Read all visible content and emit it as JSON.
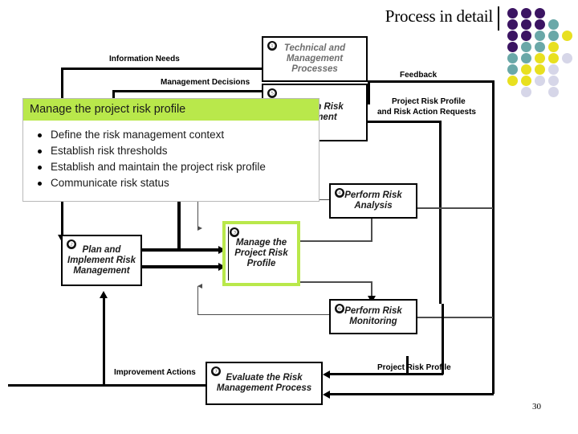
{
  "slide": {
    "title": "Process in detail",
    "page_number": "30"
  },
  "theme": {
    "accent_green": "#b9e84b",
    "dot_purple": "#3b1462",
    "dot_teal": "#6aa8a8",
    "dot_yellow": "#e8e020",
    "dot_lavender": "#d6d6e8",
    "line_black": "#000000"
  },
  "dot_grid": {
    "rows": 8,
    "cols": 5,
    "dot_size": 13,
    "step_x": 17,
    "step_y": 14,
    "pattern": [
      [
        "purple",
        "purple",
        "purple",
        "none",
        "none"
      ],
      [
        "purple",
        "purple",
        "purple",
        "teal",
        "none"
      ],
      [
        "purple",
        "purple",
        "teal",
        "teal",
        "yellow"
      ],
      [
        "purple",
        "teal",
        "teal",
        "yellow",
        "none"
      ],
      [
        "teal",
        "teal",
        "yellow",
        "yellow",
        "lavender"
      ],
      [
        "teal",
        "yellow",
        "yellow",
        "lavender",
        "none"
      ],
      [
        "yellow",
        "yellow",
        "lavender",
        "lavender",
        "none"
      ],
      [
        "none",
        "lavender",
        "none",
        "lavender",
        "none"
      ]
    ]
  },
  "callout": {
    "header": "Manage the project risk profile",
    "items": [
      "Define the risk management context",
      "Establish risk thresholds",
      "Establish and maintain the  project risk profile",
      "Communicate risk status"
    ]
  },
  "diagram": {
    "boxes": [
      {
        "id": "1",
        "number": "❶",
        "label": "Technical and Management Processes",
        "highlighted": false
      },
      {
        "id": "5",
        "number": "❺",
        "label": "Perform Risk Treatment",
        "highlighted": false
      },
      {
        "id": "2",
        "number": "❷",
        "label": "Plan and Implement Risk Management",
        "highlighted": false
      },
      {
        "id": "3",
        "number": "❸",
        "label": "Manage the Project Risk Profile",
        "highlighted": true
      },
      {
        "id": "4",
        "number": "❹",
        "label": "Perform Risk Analysis",
        "highlighted": false
      },
      {
        "id": "6",
        "number": "❻",
        "label": "Perform Risk Monitoring",
        "highlighted": false
      },
      {
        "id": "7",
        "number": "❼",
        "label": "Evaluate the Risk Management Process",
        "highlighted": false
      }
    ],
    "connector_labels": [
      {
        "id": "information-needs",
        "text": "Information Needs"
      },
      {
        "id": "management-decisions",
        "text": "Management Decisions"
      },
      {
        "id": "feedback",
        "text": "Feedback"
      },
      {
        "id": "project-risk-profile-and-risk-action-requests-line1",
        "text": "Project Risk Profile"
      },
      {
        "id": "project-risk-profile-and-risk-action-requests-line2",
        "text": "and Risk Action Requests"
      },
      {
        "id": "improvement-actions",
        "text": "Improvement Actions"
      },
      {
        "id": "project-risk-profile-bottom",
        "text": "Project Risk Profile"
      }
    ]
  }
}
